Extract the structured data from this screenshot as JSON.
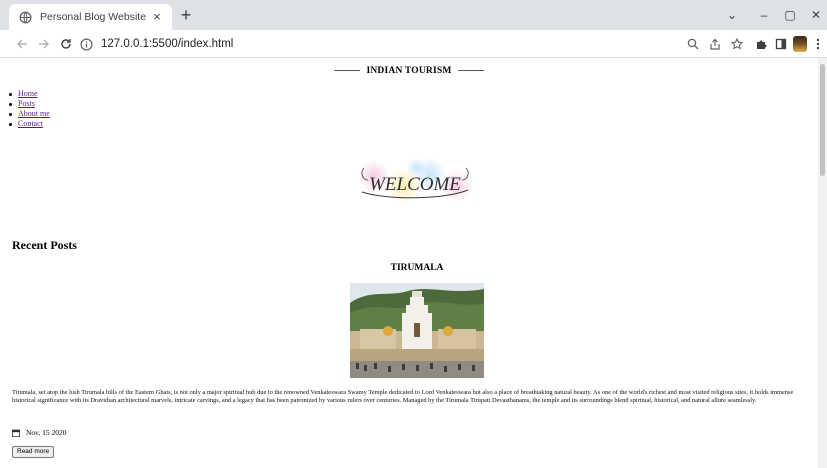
{
  "browser": {
    "tab_title": "Personal Blog Website",
    "tab_close": "×",
    "new_tab": "+",
    "url": "127.0.0.1:5500/index.html",
    "window_controls": {
      "dropdown": "⌄",
      "minimize": "–",
      "maximize": "▢",
      "close": "✕"
    },
    "icons": {
      "favicon": "globe-icon",
      "back": "arrow-left-icon",
      "forward": "arrow-right-icon",
      "reload": "reload-icon",
      "site_info": "info-icon",
      "zoom": "zoom-icon",
      "share": "share-icon",
      "bookmark": "star-icon",
      "extensions": "puzzle-icon",
      "side_panel": "side-panel-icon",
      "menu": "kebab-menu-icon"
    }
  },
  "page": {
    "site_title": "INDIAN TOURISM",
    "nav": [
      {
        "label": "Home"
      },
      {
        "label": "Posts"
      },
      {
        "label": "About me"
      },
      {
        "label": "Contact"
      }
    ],
    "welcome_text": "WELCOME",
    "section_title": "Recent Posts",
    "post": {
      "title": "TIRUMALA",
      "body": "Tirumala, set atop the lush Tirumala hills of the Eastern Ghats, is not only a major spiritual hub due to the renowned Venkateswara Swamy Temple dedicated to Lord Venkateswara but also a place of breathtaking natural beauty. As one of the world's richest and most visited religious sites, it holds immense historical significance with its Dravidian architectural marvels, intricate carvings, and a legacy that has been patronized by various rulers over centuries. Managed by the Tirumala Tirupati Devasthanams, the temple and its surroundings blend spiritual, historical, and natural allure seamlessly.",
      "date": "Nov, 15 2020",
      "read_more": "Read more"
    }
  },
  "colors": {
    "tabstrip": "#dee1e6",
    "link_visited": "#551a8b",
    "scrollbar_thumb": "#c1c1c1"
  }
}
